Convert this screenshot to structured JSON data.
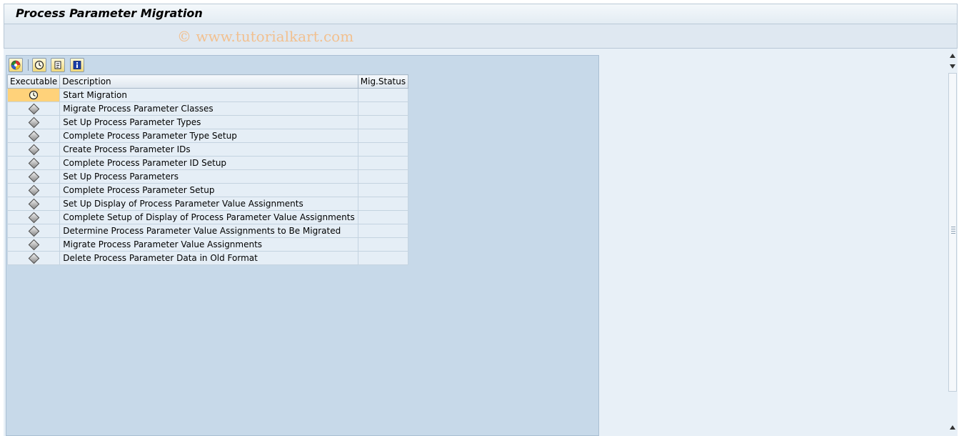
{
  "window": {
    "title": "Process Parameter Migration"
  },
  "watermark": "© www.tutorialkart.com",
  "toolbar": {
    "buttons": [
      {
        "name": "legend-button",
        "icon": "color-wheel-icon"
      },
      {
        "name": "execute-button",
        "icon": "clock-execute-icon"
      },
      {
        "name": "log-button",
        "icon": "scroll-log-icon"
      },
      {
        "name": "info-button",
        "icon": "info-icon"
      }
    ]
  },
  "grid": {
    "columns": [
      "Executable",
      "Description",
      "Mig.Status"
    ],
    "rows": [
      {
        "description": "Start Migration",
        "status": "",
        "executable_icon": "clock-execute-icon",
        "selected": true
      },
      {
        "description": "Migrate Process Parameter Classes",
        "status": "",
        "executable_icon": "diamond-icon"
      },
      {
        "description": "Set Up Process Parameter Types",
        "status": "",
        "executable_icon": "diamond-icon"
      },
      {
        "description": "Complete Process Parameter Type Setup",
        "status": "",
        "executable_icon": "diamond-icon"
      },
      {
        "description": "Create Process Parameter IDs",
        "status": "",
        "executable_icon": "diamond-icon"
      },
      {
        "description": "Complete Process Parameter ID Setup",
        "status": "",
        "executable_icon": "diamond-icon"
      },
      {
        "description": "Set Up Process Parameters",
        "status": "",
        "executable_icon": "diamond-icon"
      },
      {
        "description": "Complete Process Parameter Setup",
        "status": "",
        "executable_icon": "diamond-icon"
      },
      {
        "description": "Set Up Display of Process Parameter Value Assignments",
        "status": "",
        "executable_icon": "diamond-icon"
      },
      {
        "description": "Complete Setup of Display of Process Parameter Value Assignments",
        "status": "",
        "executable_icon": "diamond-icon"
      },
      {
        "description": "Determine Process Parameter Value Assignments to Be Migrated",
        "status": "",
        "executable_icon": "diamond-icon"
      },
      {
        "description": "Migrate Process Parameter Value Assignments",
        "status": "",
        "executable_icon": "diamond-icon"
      },
      {
        "description": "Delete Process Parameter Data in Old Format",
        "status": "",
        "executable_icon": "diamond-icon"
      }
    ]
  },
  "colors": {
    "panel": "#c7d9e9",
    "selected_cell": "#ffd27a",
    "watermark": "#f2c08f"
  }
}
